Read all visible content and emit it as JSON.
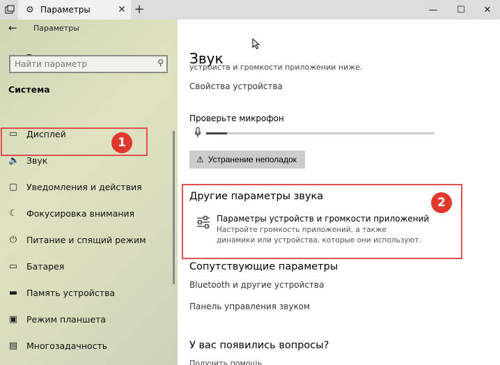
{
  "window": {
    "title": "Параметры",
    "close_tab": "✕",
    "new_tab": "+",
    "minimize": "—",
    "maximize": "☐",
    "close": "✕"
  },
  "sidebar": {
    "back": "←",
    "app_title": "Параметры",
    "home": {
      "label": "Главная",
      "icon": "home-icon"
    },
    "search": {
      "placeholder": "Найти параметр"
    },
    "section": "Система",
    "items": [
      {
        "label": "Дисплей",
        "icon": "display-icon"
      },
      {
        "label": "Звук",
        "icon": "speaker-icon"
      },
      {
        "label": "Уведомления и действия",
        "icon": "notifications-icon"
      },
      {
        "label": "Фокусировка внимания",
        "icon": "focus-icon"
      },
      {
        "label": "Питание и спящий режим",
        "icon": "power-icon"
      },
      {
        "label": "Батарея",
        "icon": "battery-icon"
      },
      {
        "label": "Память устройства",
        "icon": "storage-icon"
      },
      {
        "label": "Режим планшета",
        "icon": "tablet-icon"
      },
      {
        "label": "Многозадачность",
        "icon": "multitasking-icon"
      }
    ]
  },
  "annotations": {
    "badge1": "1",
    "badge2": "2",
    "color": "#e24e4e"
  },
  "main": {
    "title": "Звук",
    "cut_text": "устройств и громкости приложений ниже.",
    "device_properties": "Свойства устройства",
    "mic_label": "Проверьте микрофон",
    "mic_level": 0.09,
    "troubleshoot": {
      "icon": "⚠",
      "label": "Устранение неполадок"
    },
    "other_heading": "Другие параметры звука",
    "device_volume": {
      "title": "Параметры устройств и громкости приложений",
      "description": "Настройте громкость приложений, а также динамики или устройства, которые они используют."
    },
    "related_heading": "Сопутствующие параметры",
    "related_links": [
      "Bluetooth и другие устройства",
      "Панель управления звуком"
    ],
    "questions_heading": "У вас появились вопросы?",
    "help_link": "Получить помощь"
  }
}
